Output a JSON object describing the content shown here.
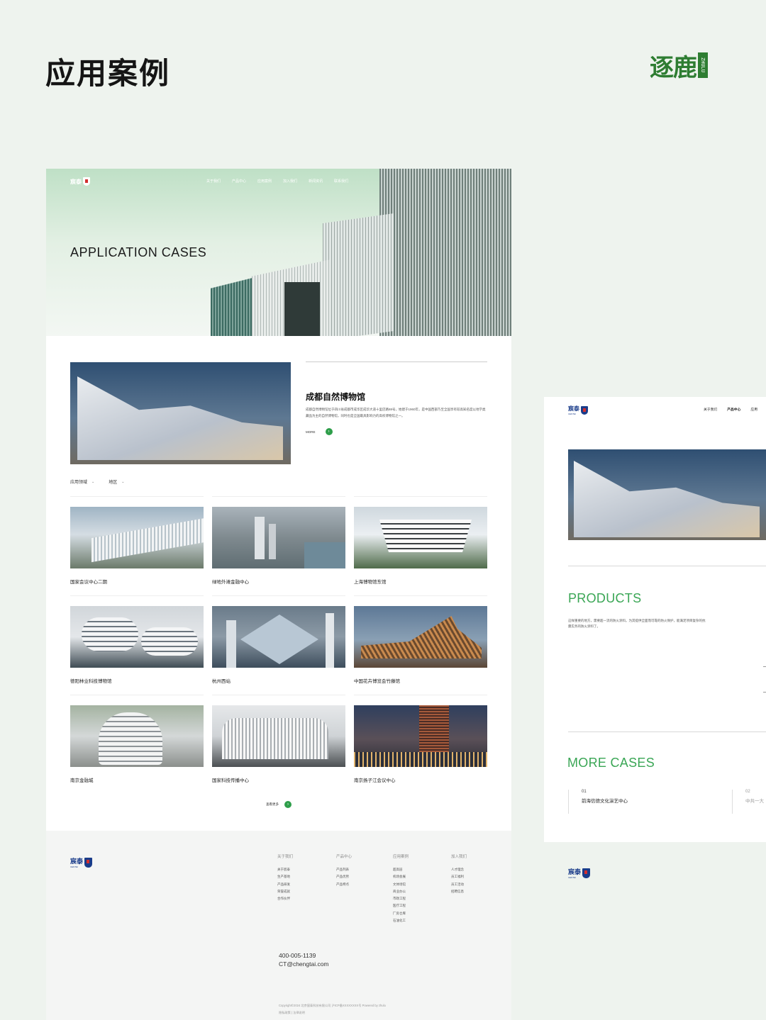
{
  "header": {
    "title": "应用案例",
    "brand_text": "逐鹿",
    "brand_tag": "ZHULU"
  },
  "main_mock": {
    "logo_text": "宸泰",
    "nav": [
      "关于我们",
      "产品中心",
      "应用案例",
      "加入我们",
      "新闻资讯",
      "联系我们"
    ],
    "hero_title": "APPLICATION CASES",
    "featured": {
      "title": "成都自然博物馆",
      "description": "成都自然博物馆位于四川省成都市成华区成华大道十里店路88号，始建于1960年，是中国西部乃至全国享有较高知名度以地学类藏品为主的自然博物馆，同时也是全国最具影响力的高校博物馆之一。",
      "more": "MORE",
      "arrow": "›"
    },
    "filters": [
      {
        "label": "应用领域",
        "icon": "chevron-down"
      },
      {
        "label": "地区",
        "icon": "chevron-down"
      }
    ],
    "cases": [
      {
        "label": "国家会议中心二期"
      },
      {
        "label": "绿地外滩金融中心"
      },
      {
        "label": "上海博物馆东馆"
      },
      {
        "label": "德阳林业科技博物馆"
      },
      {
        "label": "杭州西站"
      },
      {
        "label": "中国花卉博览会竹藤馆"
      },
      {
        "label": "南京金融城"
      },
      {
        "label": "国家科技传播中心"
      },
      {
        "label": "南京扬子江会议中心"
      }
    ],
    "see_more": "查看更多",
    "see_more_arrow": "›",
    "footer": {
      "logo_text": "宸泰",
      "logo_sub": "CENTEI",
      "columns": [
        {
          "head": "关于我们",
          "items": [
            "关于宸泰",
            "生产基地",
            "产品研发",
            "荣誉成就",
            "合作伙伴"
          ]
        },
        {
          "head": "产品中心",
          "items": [
            "产品列表",
            "产品优势",
            "产品特点"
          ]
        },
        {
          "head": "应用案例",
          "items": [
            "超高层",
            "机场会展",
            "文体场馆",
            "商业办公",
            "市政工程",
            "医疗工程",
            "厂房仓库",
            "石油化工"
          ]
        },
        {
          "head": "加入我们",
          "items": [
            "人才理念",
            "员工福利",
            "员工活动",
            "招聘信息"
          ]
        }
      ],
      "phone": "400-005-1139",
      "email": "CT@chengtai.com",
      "copyright": "Copyright©2024 北京宸泰科技有限公司 沪ICP备XXXXXXXX号 Powered by zhulu",
      "links": "隐私政策 | 法律说明"
    }
  },
  "side_mock": {
    "logo_text": "宸泰",
    "logo_sub": "CENTEI",
    "nav": [
      "关于我们",
      "产品中心",
      "应用"
    ],
    "products_title": "PRODUCTS",
    "products_desc": "这样重要的地方，需要超一流的防火涂料。为其提供全面而可靠的防火保护，能满足项目复杂的抗震实务的防火涂料了。",
    "more_cases_title": "MORE CASES",
    "more_cases": [
      {
        "num": "01",
        "name": "前海信德文化演艺中心"
      },
      {
        "num": "02",
        "name": "中共一大"
      }
    ],
    "footer_logo_text": "宸泰",
    "footer_logo_sub": "CENTEI"
  }
}
